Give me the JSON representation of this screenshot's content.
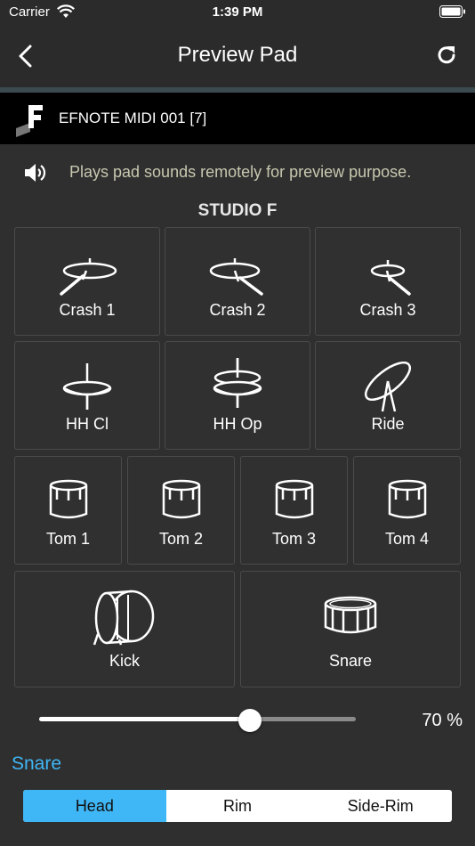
{
  "status": {
    "carrier": "Carrier",
    "time": "1:39 PM"
  },
  "nav": {
    "title": "Preview Pad"
  },
  "device": {
    "name": "EFNOTE MIDI 001 [7]"
  },
  "info": {
    "text": "Plays pad sounds remotely for preview purpose."
  },
  "kit": {
    "name": "STUDIO F"
  },
  "pads": [
    {
      "label": "Crash 1",
      "icon": "crash-cymbal-icon"
    },
    {
      "label": "Crash 2",
      "icon": "crash-cymbal-icon"
    },
    {
      "label": "Crash 3",
      "icon": "crash-cymbal-icon"
    },
    {
      "label": "HH Cl",
      "icon": "hihat-closed-icon"
    },
    {
      "label": "HH Op",
      "icon": "hihat-open-icon"
    },
    {
      "label": "Ride",
      "icon": "ride-cymbal-icon"
    },
    {
      "label": "Tom 1",
      "icon": "tom-drum-icon"
    },
    {
      "label": "Tom 2",
      "icon": "tom-drum-icon"
    },
    {
      "label": "Tom 3",
      "icon": "tom-drum-icon"
    },
    {
      "label": "Tom 4",
      "icon": "tom-drum-icon"
    },
    {
      "label": "Kick",
      "icon": "kick-drum-icon"
    },
    {
      "label": "Snare",
      "icon": "snare-drum-icon"
    }
  ],
  "volume": {
    "value": 70,
    "label": "70 %"
  },
  "selected_pad": "Snare",
  "segments": [
    {
      "label": "Head",
      "active": true
    },
    {
      "label": "Rim",
      "active": false
    },
    {
      "label": "Side-Rim",
      "active": false
    }
  ],
  "colors": {
    "accent": "#3fb6f5",
    "background": "#2f2f2f",
    "device_bar": "#000000"
  }
}
